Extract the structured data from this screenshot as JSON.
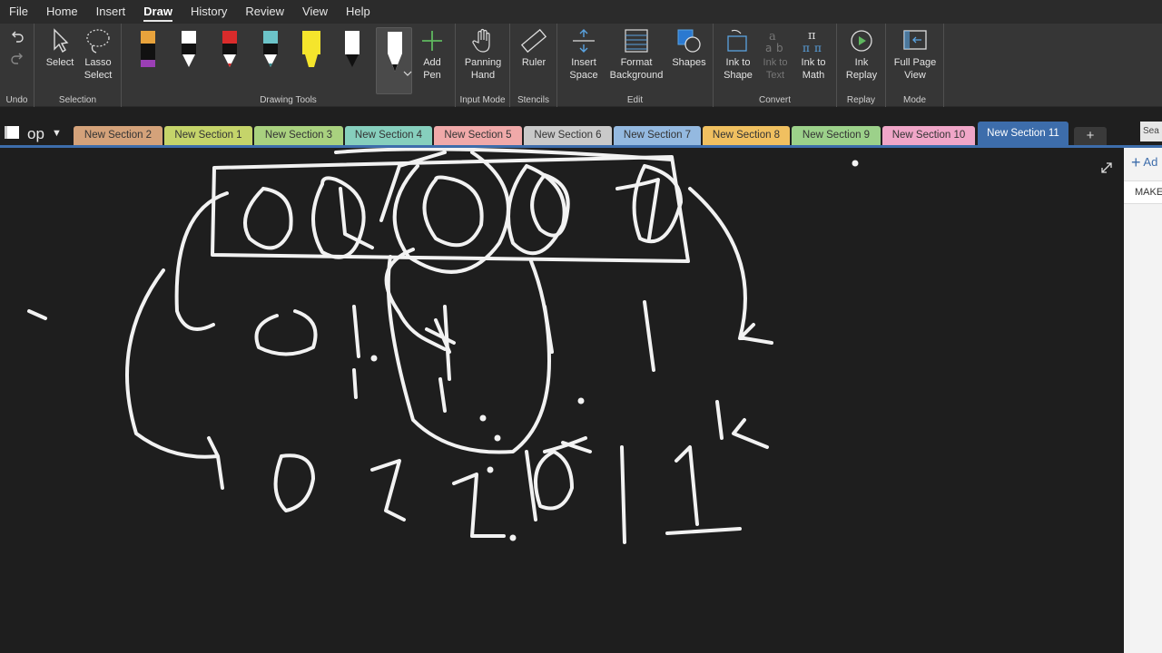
{
  "menu": [
    "File",
    "Home",
    "Insert",
    "Draw",
    "History",
    "Review",
    "View",
    "Help"
  ],
  "menu_active": "Draw",
  "ribbon": {
    "undo_label": "Undo",
    "selection": {
      "label": "Selection",
      "select": "Select",
      "lasso": "Lasso Select"
    },
    "drawing_tools": {
      "label": "Drawing Tools",
      "add_pen": "Add Pen",
      "pen_colors": [
        "#e8a33c",
        "#ffffff",
        "#d92b2b",
        "#6cc4c9",
        "#f5e52c",
        "#ffffff",
        "#ffffff"
      ]
    },
    "input_mode": {
      "label": "Input Mode",
      "panning_hand": "Panning Hand"
    },
    "stencils": {
      "label": "Stencils",
      "ruler": "Ruler"
    },
    "edit": {
      "label": "Edit",
      "insert_space": "Insert Space",
      "format_background": "Format Background",
      "shapes": "Shapes"
    },
    "convert": {
      "label": "Convert",
      "ink_to_shape": "Ink to Shape",
      "ink_to_text": "Ink to Text",
      "ink_to_math": "Ink to Math"
    },
    "replay": {
      "label": "Replay",
      "ink_replay": "Ink Replay"
    },
    "mode": {
      "label": "Mode",
      "full_page_view": "Full Page View"
    }
  },
  "notebook": {
    "name": "op"
  },
  "tabs": [
    {
      "label": "New Section 2",
      "color": "#d4a27a"
    },
    {
      "label": "New Section 1",
      "color": "#c5d46a"
    },
    {
      "label": "New Section 3",
      "color": "#a9d17f"
    },
    {
      "label": "New Section 4",
      "color": "#86cfbd"
    },
    {
      "label": "New Section 5",
      "color": "#f0a9a9"
    },
    {
      "label": "New Section 6",
      "color": "#c9c9c9"
    },
    {
      "label": "New Section 7",
      "color": "#94b9e0"
    },
    {
      "label": "New Section 8",
      "color": "#f0c060"
    },
    {
      "label": "New Section 9",
      "color": "#9cd18a"
    },
    {
      "label": "New Section 10",
      "color": "#f0a6c8"
    },
    {
      "label": "New Section 11",
      "color": "#3d6dab"
    }
  ],
  "tab_add": "+",
  "search_stub": "Sea",
  "page_panel": {
    "add_page": "Ad",
    "page_item": "MAKE"
  }
}
